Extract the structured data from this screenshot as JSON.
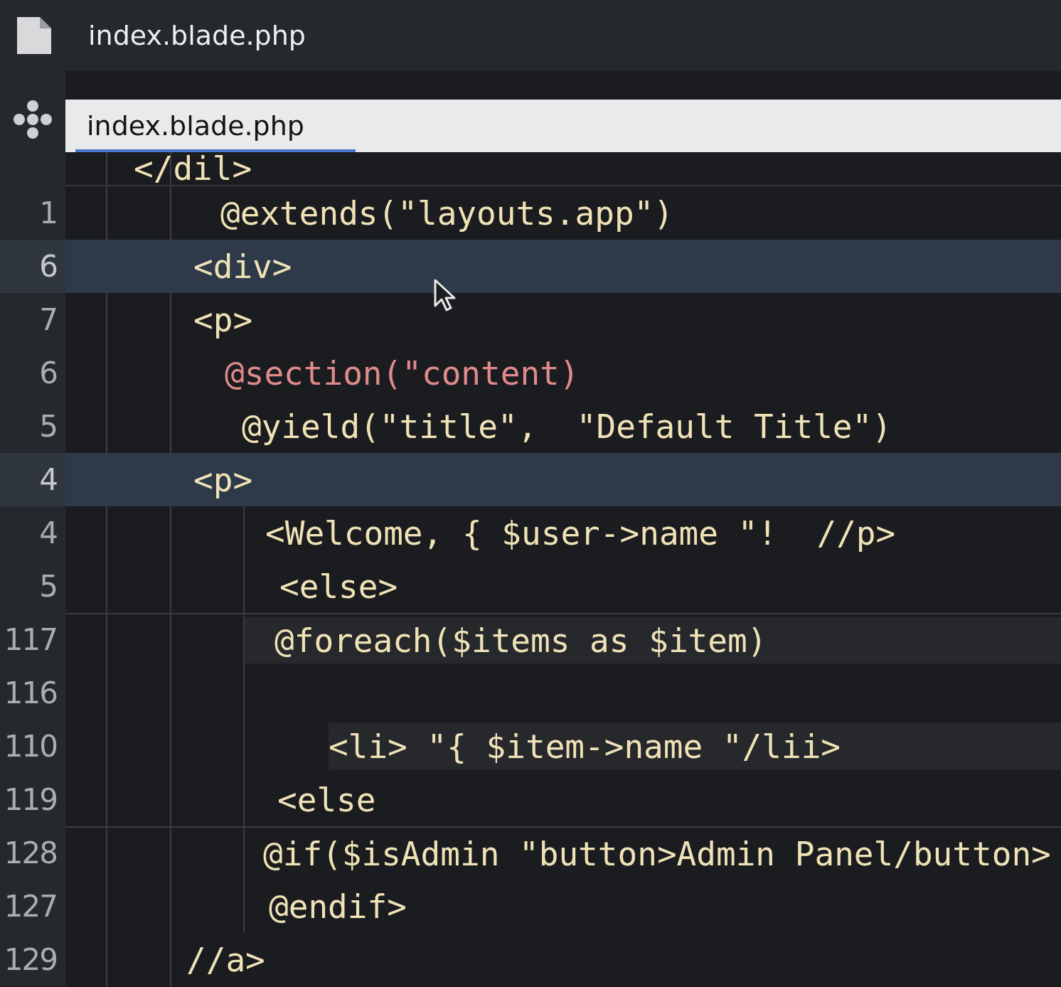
{
  "file_header": {
    "title": "index.blade.php"
  },
  "tab": {
    "label": "index.blade.php",
    "selected": true
  },
  "partial_line": {
    "code": "</dil>"
  },
  "lines": [
    {
      "number": "1",
      "code": "@extends(\"layouts.app\")",
      "highlighted": false,
      "color": "#efe2b6"
    },
    {
      "number": "6",
      "code": "<div>",
      "highlighted": true,
      "color": "#efe2b6"
    },
    {
      "number": "7",
      "code": "<p>",
      "highlighted": false,
      "color": "#efe2b6"
    },
    {
      "number": "6",
      "code": "@section(\"content)",
      "highlighted": false,
      "color": "#df8a8c"
    },
    {
      "number": "5",
      "code": "@yield(\"title\",  \"Default Title\")",
      "highlighted": false,
      "color": "#efe2b6"
    },
    {
      "number": "4",
      "code": "<p>",
      "highlighted": true,
      "color": "#efe2b6"
    },
    {
      "number": "4",
      "code": "<Welcome, { $user->name \"!  //p>",
      "highlighted": false,
      "color": "#efe2b6"
    },
    {
      "number": "5",
      "code": "<else>",
      "highlighted": false,
      "color": "#efe2b6"
    },
    {
      "number": "117",
      "code": "@foreach($items as $item)",
      "highlighted": false,
      "color": "#efe2b6"
    },
    {
      "number": "116",
      "highlighted": false
    },
    {
      "number": "110",
      "code": "<li> \"{ $item->name \"/lii>",
      "highlighted": false,
      "color": "#efe2b6"
    },
    {
      "number": "119",
      "code": "<else",
      "highlighted": false,
      "color": "#efe2b6"
    },
    {
      "number": "128",
      "code": "@if($isAdmin \"button>Admin Panel/button>",
      "highlighted": false,
      "color": "#efe2b6"
    },
    {
      "number": "127",
      "code": "@endif>",
      "highlighted": false,
      "color": "#efe2b6"
    },
    {
      "number": "129",
      "code": "//a>",
      "highlighted": false,
      "color": "#efe2b6"
    }
  ]
}
